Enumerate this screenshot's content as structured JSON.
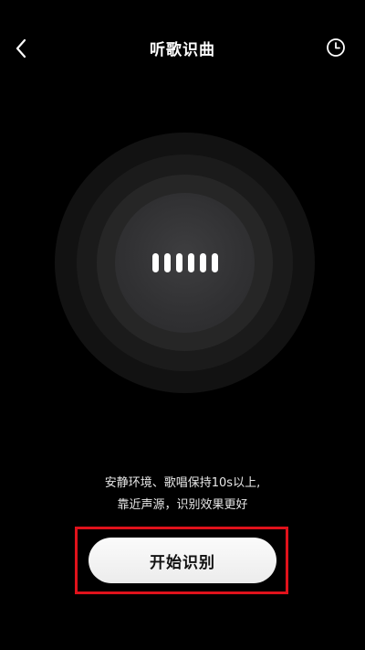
{
  "header": {
    "title": "听歌识曲",
    "back_icon": "chevron-left-icon",
    "history_icon": "clock-icon"
  },
  "visualizer": {
    "bar_count": 6,
    "bar_color": "#ffffff"
  },
  "hint": {
    "line1": "安静环境、歌唱保持10s以上,",
    "line2": "靠近声源，识别效果更好"
  },
  "actions": {
    "start_label": "开始识别",
    "highlight_color": "#e0121b"
  }
}
